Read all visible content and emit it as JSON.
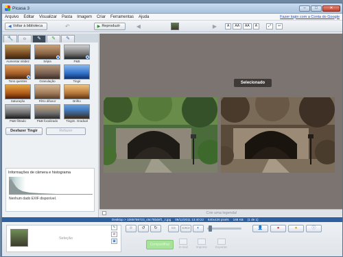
{
  "window": {
    "title": "Picasa 3",
    "controls": [
      "–",
      "□",
      "✕"
    ]
  },
  "menu": {
    "items": [
      "Arquivo",
      "Editar",
      "Visualizar",
      "Pasta",
      "Imagem",
      "Criar",
      "Ferramentas",
      "Ajuda"
    ],
    "signin": "Fazer login com a Conta do Google"
  },
  "toolbar": {
    "back_label": "Voltar à biblioteca",
    "play_label": "Reproduzir",
    "text_sizes": [
      "A",
      "AA",
      "AA",
      "A"
    ]
  },
  "tabs": [
    "wrench-icon",
    "sun-icon",
    "brush-icon",
    "green-brush-icon",
    "blue-brush-icon"
  ],
  "effects": [
    {
      "label": "Aumentar nitidez",
      "cls": "t-sharpen",
      "badge": false
    },
    {
      "label": "Sépia",
      "cls": "t-sepia",
      "badge": true
    },
    {
      "label": "P&B",
      "cls": "t-bw",
      "badge": true
    },
    {
      "label": "Tons quentes",
      "cls": "t-warm",
      "badge": true
    },
    {
      "label": "Granulação",
      "cls": "t-grain",
      "badge": false
    },
    {
      "label": "Tingir",
      "cls": "t-tint",
      "badge": false
    },
    {
      "label": "Saturação",
      "cls": "t-sat",
      "badge": false
    },
    {
      "label": "Filtro difusor",
      "cls": "t-soft",
      "badge": false
    },
    {
      "label": "Brilho",
      "cls": "t-glow",
      "badge": false
    },
    {
      "label": "P&B filtrado",
      "cls": "t-filmbw",
      "badge": false
    },
    {
      "label": "P&B focalizado",
      "cls": "t-focbw",
      "badge": false
    },
    {
      "label": "Tingim. Gradual",
      "cls": "t-grad",
      "badge": false
    }
  ],
  "actions": {
    "undo": "Desfazer Tingir",
    "redo": "Refazer"
  },
  "info_panel": {
    "heading": "Informações de câmera e histograma",
    "exif": "Nenhum dado EXIF disponível."
  },
  "viewer": {
    "selected_label": "Selecionado"
  },
  "caption": {
    "placeholder": "Crie uma legenda!"
  },
  "status": {
    "path": "Desktop > 1065759723_c6c75bdef1_z.jpg",
    "date": "09/12/2011 13:40:22",
    "size_px": "640x426 pixels",
    "size_kb": "168 KB",
    "count": "(1 de 1)"
  },
  "tray": {
    "label": "Seleção"
  },
  "bottom": {
    "upload": "Compartilhar",
    "mini": [
      "E-mail",
      "Imprimir",
      "Exportar"
    ]
  },
  "zoom": {
    "level": 0.05
  },
  "colors": {
    "status_bar": "#2e5f9e",
    "viewer_bg": "#7b7470",
    "upload_btn": "#a7e39a"
  }
}
